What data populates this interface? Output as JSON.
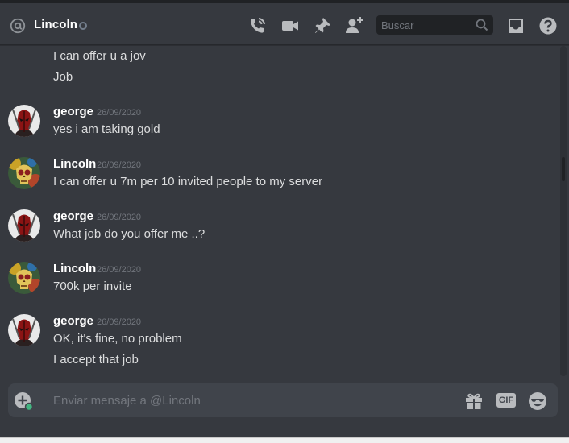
{
  "header": {
    "channel_name": "Lincoln",
    "search_placeholder": "Buscar"
  },
  "messages": [
    {
      "lines": [
        "I can offer u a jov",
        "Job"
      ]
    },
    {
      "author": "george",
      "timestamp": "26/09/2020",
      "lines": [
        "yes i am taking gold"
      ]
    },
    {
      "author": "Lincoln",
      "timestamp": "26/09/2020",
      "lines": [
        "I can offer u 7m per 10 invited people to my server"
      ]
    },
    {
      "author": "george",
      "timestamp": "26/09/2020",
      "lines": [
        "What job do you offer me ..?"
      ]
    },
    {
      "author": "Lincoln",
      "timestamp": "26/09/2020",
      "lines": [
        "700k per invite"
      ]
    },
    {
      "author": "george",
      "timestamp": "26/09/2020",
      "lines": [
        "OK, it's fine, no problem",
        "I accept that job"
      ]
    }
  ],
  "composer": {
    "placeholder": "Enviar mensaje a @Lincoln",
    "gif_label": "GIF"
  },
  "colors": {
    "background": "#36393f",
    "header_text": "#ffffff",
    "muted": "#72767d",
    "composer_bg": "#40444b"
  }
}
